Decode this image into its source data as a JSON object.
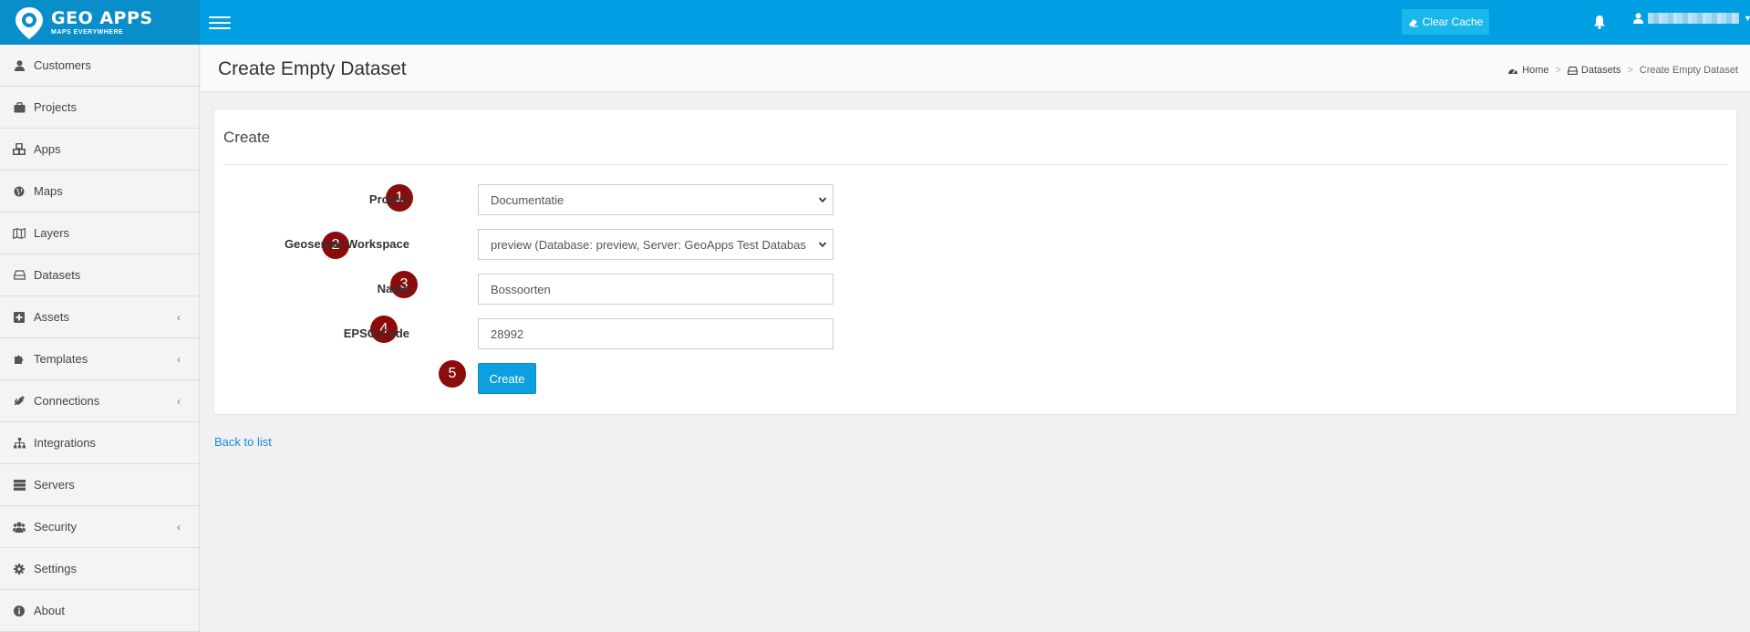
{
  "app": {
    "logo_title": "GEO APPS",
    "logo_subtitle": "MAPS EVERYWHERE",
    "brand_color": "#009fe3"
  },
  "topbar": {
    "clear_cache_label": "Clear Cache",
    "menu_icon": "hamburger-icon",
    "notifications_icon": "bell-icon",
    "user_icon": "user-icon"
  },
  "sidebar": {
    "items": [
      {
        "label": "Customers",
        "icon": "user-icon",
        "has_children": false
      },
      {
        "label": "Projects",
        "icon": "briefcase-icon",
        "has_children": false
      },
      {
        "label": "Apps",
        "icon": "cubes-icon",
        "has_children": false
      },
      {
        "label": "Maps",
        "icon": "globe-icon",
        "has_children": false
      },
      {
        "label": "Layers",
        "icon": "map-icon",
        "has_children": false
      },
      {
        "label": "Datasets",
        "icon": "hdd-icon",
        "has_children": false
      },
      {
        "label": "Assets",
        "icon": "plus-square-icon",
        "has_children": true
      },
      {
        "label": "Templates",
        "icon": "puzzle-icon",
        "has_children": true
      },
      {
        "label": "Connections",
        "icon": "plug-icon",
        "has_children": true
      },
      {
        "label": "Integrations",
        "icon": "sitemap-icon",
        "has_children": false
      },
      {
        "label": "Servers",
        "icon": "server-icon",
        "has_children": false
      },
      {
        "label": "Security",
        "icon": "users-icon",
        "has_children": true
      },
      {
        "label": "Settings",
        "icon": "gear-icon",
        "has_children": false
      },
      {
        "label": "About",
        "icon": "info-icon",
        "has_children": false
      }
    ]
  },
  "page": {
    "title": "Create Empty Dataset",
    "breadcrumb": {
      "home": "Home",
      "datasets": "Datasets",
      "current": "Create Empty Dataset"
    }
  },
  "form": {
    "card_title": "Create",
    "project": {
      "label": "Project",
      "value": "Documentatie",
      "badge": "1"
    },
    "workspace": {
      "label": "Geoserver Workspace",
      "value": "preview (Database: preview, Server: GeoApps Test Databas",
      "badge": "2"
    },
    "name": {
      "label": "Name",
      "value": "Bossoorten",
      "badge": "3"
    },
    "epsg": {
      "label": "EPSG Code",
      "value": "28992",
      "badge": "4"
    },
    "submit": {
      "label": "Create",
      "badge": "5"
    }
  },
  "back_link": "Back to list"
}
